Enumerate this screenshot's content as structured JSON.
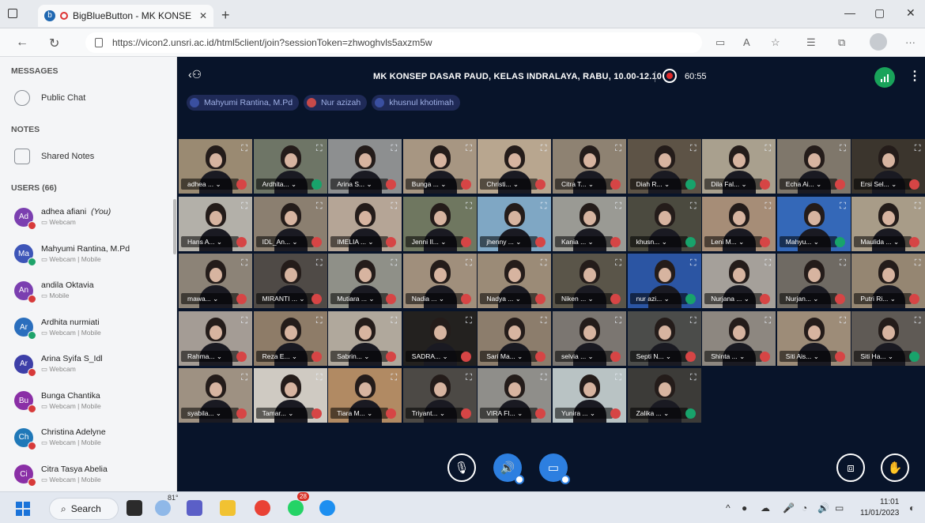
{
  "browser": {
    "tab_title": "BigBlueButton - MK KONSE",
    "tab_favicon": "b",
    "url": "https://vicon2.unsri.ac.id/html5client/join?sessionToken=zhwoghvls5axzm5w"
  },
  "sidebar": {
    "messages_heading": "MESSAGES",
    "public_chat": "Public Chat",
    "notes_heading": "NOTES",
    "shared_notes": "Shared Notes",
    "users_heading": "USERS (66)",
    "users": [
      {
        "initials": "Ad",
        "name": "adhea afiani",
        "you": "(You)",
        "status": "Webcam",
        "color": "#7b3fb0",
        "badge": "red"
      },
      {
        "initials": "Ma",
        "name": "Mahyumi Rantina, M.Pd",
        "you": "",
        "status": "Webcam | Mobile",
        "color": "#3d55b8",
        "badge": "green"
      },
      {
        "initials": "An",
        "name": "andila Oktavia",
        "you": "",
        "status": "Mobile",
        "color": "#7b3fb0",
        "badge": "red"
      },
      {
        "initials": "Ar",
        "name": "Ardhita nurmiati",
        "you": "",
        "status": "Webcam | Mobile",
        "color": "#2a6ebd",
        "badge": "green"
      },
      {
        "initials": "Ar",
        "name": "Arina Syifa S_Idl",
        "you": "",
        "status": "Webcam",
        "color": "#3d3fa8",
        "badge": "red"
      },
      {
        "initials": "Bu",
        "name": "Bunga Chantika",
        "you": "",
        "status": "Webcam | Mobile",
        "color": "#8a2fa6",
        "badge": "red"
      },
      {
        "initials": "Ch",
        "name": "Christina Adelyne",
        "you": "",
        "status": "Webcam | Mobile",
        "color": "#1f78b8",
        "badge": "red"
      },
      {
        "initials": "Ci",
        "name": "Citra Tasya Abelia",
        "you": "",
        "status": "Webcam | Mobile",
        "color": "#8a2fa6",
        "badge": "red"
      }
    ]
  },
  "meeting": {
    "title": "MK KONSEP DASAR PAUD, KELAS INDRALAYA, RABU, 10.00-12.10",
    "timer": "60:55",
    "talkers": [
      {
        "name": "Mahyumi Rantina, M.Pd",
        "muted": false
      },
      {
        "name": "Nur azizah",
        "muted": true
      },
      {
        "name": "khusnul khotimah",
        "muted": false
      }
    ],
    "colors": {
      "tile_mic_muted": "#d64545",
      "tile_mic_on": "#18a36b",
      "accent": "#2d7fe0"
    },
    "tiles": [
      {
        "label": "adhea ...",
        "mic": "red",
        "bg": "#9a8a72"
      },
      {
        "label": "Ardhita...",
        "mic": "green",
        "bg": "#6e7566"
      },
      {
        "label": "Arina S...",
        "mic": "red",
        "bg": "#8d8f90"
      },
      {
        "label": "Bunga ...",
        "mic": "red",
        "bg": "#a79682"
      },
      {
        "label": "Christi...",
        "mic": "red",
        "bg": "#b8a68f"
      },
      {
        "label": "Citra T...",
        "mic": "red",
        "bg": "#8e8272"
      },
      {
        "label": "Diah R...",
        "mic": "green",
        "bg": "#5d5346"
      },
      {
        "label": "Dila Fal...",
        "mic": "red",
        "bg": "#a9a08e"
      },
      {
        "label": "Echa Ai...",
        "mic": "red",
        "bg": "#7f776b"
      },
      {
        "label": "Ersi Sel...",
        "mic": "red",
        "bg": "#3b352d"
      },
      {
        "label": "Hans A...",
        "mic": "red",
        "bg": "#b3b0a9"
      },
      {
        "label": "IDL_An...",
        "mic": "red",
        "bg": "#8b7f70"
      },
      {
        "label": "IMELIA ...",
        "mic": "red",
        "bg": "#b5a596"
      },
      {
        "label": "Jenni Il...",
        "mic": "red",
        "bg": "#6f7760"
      },
      {
        "label": "jhenny ...",
        "mic": "red",
        "bg": "#7fa7c4"
      },
      {
        "label": "Kania ...",
        "mic": "red",
        "bg": "#9a9a94"
      },
      {
        "label": "khusn...",
        "mic": "green",
        "bg": "#4b4a3f"
      },
      {
        "label": "Leni M...",
        "mic": "red",
        "bg": "#a68d77"
      },
      {
        "label": "Mahyu...",
        "mic": "green",
        "bg": "#3468b8"
      },
      {
        "label": "Maulida ...",
        "mic": "red",
        "bg": "#a89c88"
      },
      {
        "label": "mawa...",
        "mic": "red",
        "bg": "#8c8377"
      },
      {
        "label": "MIRANTI ...",
        "mic": "red",
        "bg": "#4f4a46"
      },
      {
        "label": "Mutiara ...",
        "mic": "red",
        "bg": "#8f9088"
      },
      {
        "label": "Nadia ...",
        "mic": "red",
        "bg": "#a08f7c"
      },
      {
        "label": "Nadya ...",
        "mic": "red",
        "bg": "#9b8b77"
      },
      {
        "label": "Niken ...",
        "mic": "red",
        "bg": "#5a5549"
      },
      {
        "label": "nur azi...",
        "mic": "green",
        "bg": "#2b55a3"
      },
      {
        "label": "Nurjana ...",
        "mic": "red",
        "bg": "#a5a09a"
      },
      {
        "label": "Nurjan...",
        "mic": "red",
        "bg": "#6f6a63"
      },
      {
        "label": "Putri Ri...",
        "mic": "red",
        "bg": "#958672"
      },
      {
        "label": "Rahma...",
        "mic": "red",
        "bg": "#a49c95"
      },
      {
        "label": "Reza E...",
        "mic": "red",
        "bg": "#8e7c68"
      },
      {
        "label": "Sabrin...",
        "mic": "red",
        "bg": "#b0a89c"
      },
      {
        "label": "SADRA...",
        "mic": "red",
        "bg": "#23211f"
      },
      {
        "label": "Sari Ma...",
        "mic": "red",
        "bg": "#8c7d6c"
      },
      {
        "label": "selvia ...",
        "mic": "red",
        "bg": "#7b7671"
      },
      {
        "label": "Septi N...",
        "mic": "red",
        "bg": "#4b4c4a"
      },
      {
        "label": "Shinta ...",
        "mic": "red",
        "bg": "#8d8780"
      },
      {
        "label": "Siti Ais...",
        "mic": "red",
        "bg": "#9d8c78"
      },
      {
        "label": "Siti Ha...",
        "mic": "green",
        "bg": "#5f5a55"
      },
      {
        "label": "syabila...",
        "mic": "red",
        "bg": "#9e9182"
      },
      {
        "label": "Tamar...",
        "mic": "red",
        "bg": "#cfcac2"
      },
      {
        "label": "Tiara M...",
        "mic": "red",
        "bg": "#b18a63"
      },
      {
        "label": "Triyant...",
        "mic": "red",
        "bg": "#4c4945"
      },
      {
        "label": "VIRA FI...",
        "mic": "red",
        "bg": "#8f8e8a"
      },
      {
        "label": "Yunira ...",
        "mic": "red",
        "bg": "#b9c3c4"
      },
      {
        "label": "Zalika ...",
        "mic": "green",
        "bg": "#3c3b38"
      }
    ]
  },
  "taskbar": {
    "search": "Search",
    "weather": "81°",
    "notif_badge": "28",
    "time": "11:01",
    "date": "11/01/2023"
  }
}
